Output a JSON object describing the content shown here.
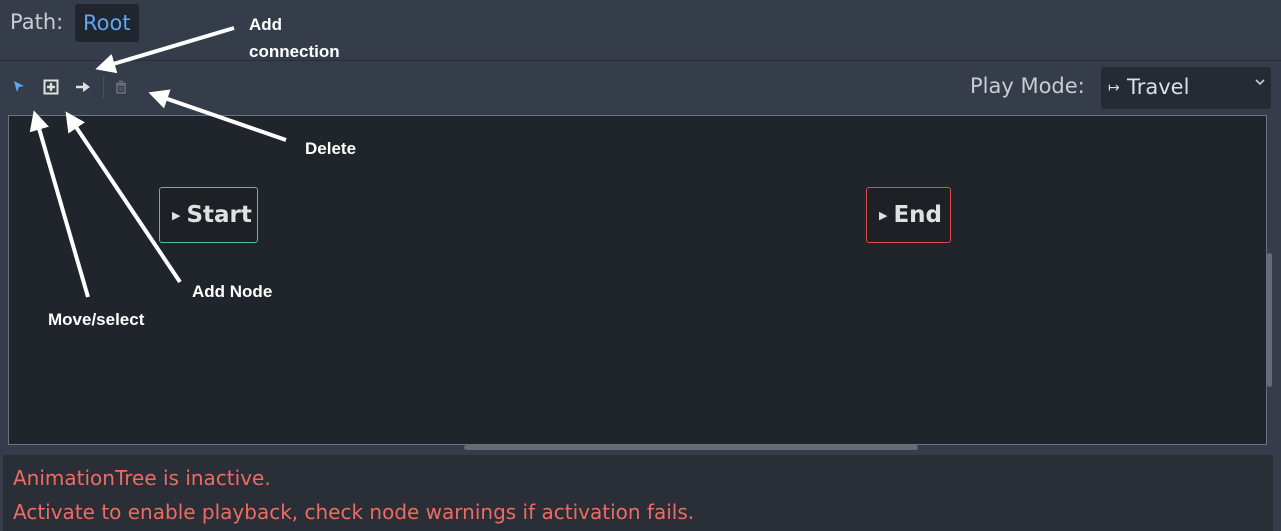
{
  "path": {
    "label": "Path:",
    "root": "Root"
  },
  "toolbar": {
    "tools": [
      {
        "name": "select-move-icon",
        "active": true
      },
      {
        "name": "add-node-icon",
        "active": false
      },
      {
        "name": "connect-icon",
        "active": false
      },
      {
        "name": "delete-icon",
        "active": false
      }
    ],
    "play_mode_label": "Play Mode:",
    "play_mode_value": "Travel",
    "play_mode_icon": "↦"
  },
  "graph": {
    "nodes": [
      {
        "label": "Start",
        "border_color": "#4fbfa4"
      },
      {
        "label": "End",
        "border_color": "#dd4b4b"
      }
    ]
  },
  "status": {
    "line1": "AnimationTree is inactive.",
    "line2": "Activate to enable playback, check node warnings if activation fails.",
    "color": "#ee6b63"
  },
  "annotations": {
    "add_connection_1": "Add",
    "add_connection_2": "connection",
    "delete": "Delete",
    "add_node": "Add Node",
    "move_select": "Move/select"
  },
  "colors": {
    "accent": "#5fa6f0",
    "background": "#363d4a",
    "graph_bg": "#20242b"
  }
}
